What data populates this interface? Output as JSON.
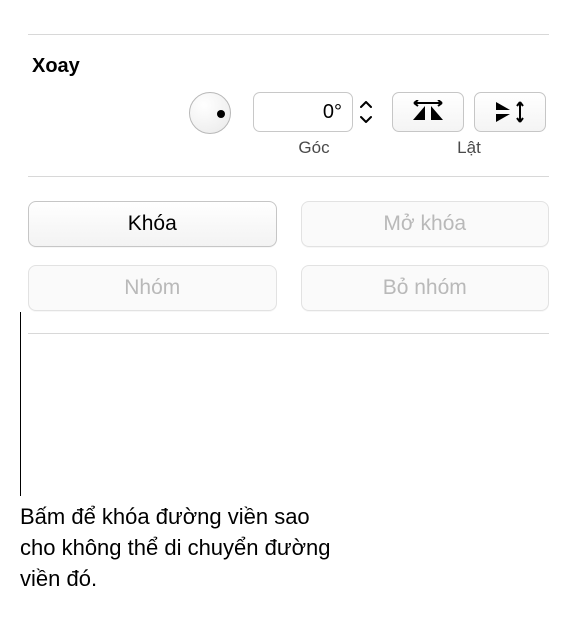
{
  "rotate": {
    "title": "Xoay",
    "angle_value": "0°",
    "angle_label": "Góc",
    "flip_label": "Lật"
  },
  "buttons": {
    "lock": "Khóa",
    "unlock": "Mở khóa",
    "group": "Nhóm",
    "ungroup": "Bỏ nhóm"
  },
  "callout": {
    "text": "Bấm để khóa đường viền sao cho không thể di chuyển đường viền đó."
  }
}
